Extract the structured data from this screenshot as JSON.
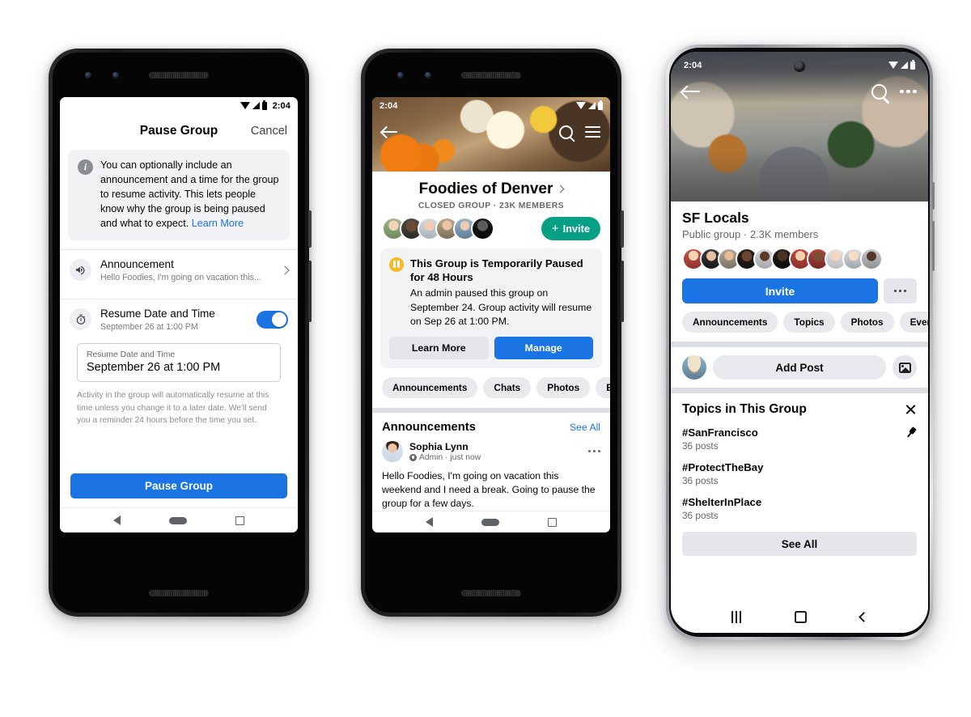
{
  "phone1": {
    "statusbar": {
      "time": "2:04",
      "icons": [
        "wifi-icon",
        "signal-icon",
        "battery-icon"
      ]
    },
    "header": {
      "title": "Pause Group",
      "cancel_label": "Cancel"
    },
    "notice": {
      "icon": "info-icon",
      "text": "You can optionally include an announcement and a time for the group to resume activity. This lets people know why the group is being paused and what to expect. ",
      "link_label": "Learn More"
    },
    "rows": [
      {
        "icon": "megaphone-icon",
        "title": "Announcement",
        "subtitle": "Hello Foodies, I'm going on vacation this...",
        "accessory": "chevron-right-icon"
      },
      {
        "icon": "stopwatch-icon",
        "title": "Resume Date and Time",
        "subtitle": "September 26 at 1:00 PM",
        "accessory": "toggle-on"
      }
    ],
    "field": {
      "label": "Resume Date and Time",
      "value": "September 26 at 1:00 PM"
    },
    "help_text": "Activity in the group will automatically resume at this time unless you change it to a later date. We'll send you a reminder 24 hours before the time you set.",
    "cta_label": "Pause Group",
    "navbar": [
      "back-icon",
      "home-icon",
      "recents-icon"
    ]
  },
  "phone2": {
    "statusbar": {
      "time": "2:04",
      "icons": [
        "wifi-icon",
        "signal-icon",
        "battery-icon"
      ]
    },
    "topbar": {
      "back": "back-arrow-icon",
      "search": "search-icon",
      "menu": "hamburger-icon"
    },
    "group": {
      "name": "Foodies of Denver",
      "chevron": "chevron-right-icon",
      "meta": "CLOSED GROUP · 23K MEMBERS",
      "invite_label": "Invite",
      "invite_plus": "+",
      "invite_color": "#089f85",
      "facepile_count": 6
    },
    "paused_banner": {
      "icon": "pause-badge-icon",
      "title": "This Group is Temporarily Paused for 48 Hours",
      "description": "An admin paused this group on September 24. Group activity will resume on Sep 26 at 1:00 PM.",
      "secondary_label": "Learn More",
      "primary_label": "Manage",
      "primary_color": "#1b74e4"
    },
    "chips": [
      "Announcements",
      "Chats",
      "Photos",
      "Events"
    ],
    "announcements": {
      "title": "Announcements",
      "see_all_label": "See All",
      "post": {
        "author": "Sophia Lynn",
        "badge_icon": "admin-shield-icon",
        "meta": "Admin · just now",
        "menu_icon": "more-horizontal-icon",
        "body": "Hello Foodies, I'm going on vacation this weekend and I need a break. Going to pause the group for a few days."
      }
    },
    "navbar": [
      "back-icon",
      "home-icon",
      "recents-icon"
    ]
  },
  "phone3": {
    "statusbar": {
      "time": "2:04",
      "icons": [
        "wifi-icon",
        "signal-icon",
        "battery-icon"
      ]
    },
    "topbar": {
      "back": "back-arrow-icon",
      "search": "search-icon",
      "more": "more-horizontal-icon"
    },
    "group": {
      "name": "SF Locals",
      "meta": "Public group · 2.3K members",
      "invite_label": "Invite",
      "invite_color": "#1b74e4",
      "more_icon": "more-horizontal-icon",
      "facepile_count": 11
    },
    "chips": [
      "Announcements",
      "Topics",
      "Photos",
      "Events"
    ],
    "composer": {
      "avatar": "user-avatar",
      "add_post_label": "Add Post",
      "photo_icon": "photo-icon"
    },
    "topics": {
      "title": "Topics in This Group",
      "close_icon": "close-icon",
      "items": [
        {
          "tag": "#SanFrancisco",
          "count": "36 posts",
          "pinned": true,
          "pin_icon": "pin-icon"
        },
        {
          "tag": "#ProtectTheBay",
          "count": "36 posts",
          "pinned": false
        },
        {
          "tag": "#ShelterInPlace",
          "count": "36 posts",
          "pinned": false
        }
      ],
      "see_all_label": "See All"
    },
    "navbar": [
      "recents-icon",
      "home-icon",
      "back-icon"
    ]
  }
}
